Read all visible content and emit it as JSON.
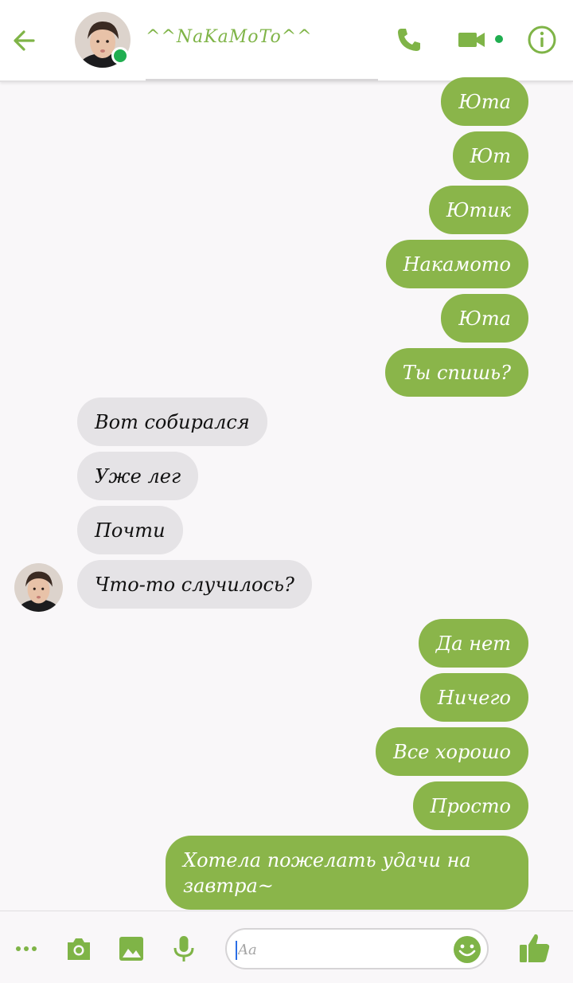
{
  "header": {
    "contact_name": "^^NaKaMoTo^^",
    "online": true
  },
  "messages": [
    {
      "side": "out",
      "text": "Юта"
    },
    {
      "side": "out",
      "text": "Ют"
    },
    {
      "side": "out",
      "text": "Ютик"
    },
    {
      "side": "out",
      "text": "Накамото"
    },
    {
      "side": "out",
      "text": "Юта"
    },
    {
      "side": "out",
      "text": "Ты спишь?"
    },
    {
      "side": "in",
      "text": "Вот собирался"
    },
    {
      "side": "in",
      "text": "Уже лег"
    },
    {
      "side": "in",
      "text": "Почти"
    },
    {
      "side": "in",
      "text": "Что-то случилось?"
    },
    {
      "side": "out",
      "text": "Да нет"
    },
    {
      "side": "out",
      "text": "Ничего"
    },
    {
      "side": "out",
      "text": "Все хорошо"
    },
    {
      "side": "out",
      "text": "Просто"
    },
    {
      "side": "out",
      "text": "Хотела пожелать удачи на завтра~"
    }
  ],
  "composer": {
    "placeholder": "Aa"
  },
  "colors": {
    "accent": "#7fb447",
    "outgoing_bubble": "#8ab54a",
    "incoming_bubble": "#e5e3e6",
    "online": "#20ae50"
  },
  "icons": [
    "back-arrow-icon",
    "phone-icon",
    "video-camera-icon",
    "info-icon",
    "more-dots-icon",
    "camera-icon",
    "image-icon",
    "microphone-icon",
    "emoji-icon",
    "thumbs-up-icon"
  ]
}
